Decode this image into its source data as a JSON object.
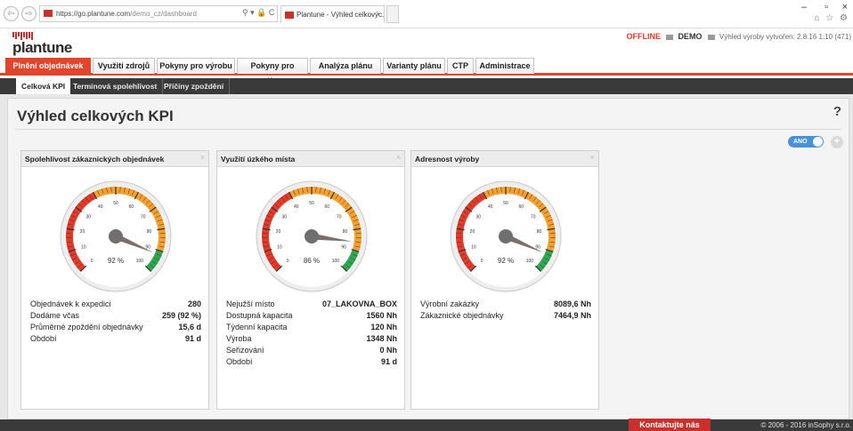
{
  "browser": {
    "url_host": "https://go.plantune.com",
    "url_path": "/demo_cz/dashboard",
    "tab_title": "Plantune - Výhled celkovýc...",
    "tab_close": "×",
    "back": "⇦",
    "forward": "⇨",
    "addr_tools": "⚲ ▾ 🔒 C",
    "minimize": "–",
    "restore": "▫",
    "close": "×",
    "icons": "⌂ ☆ ⚙"
  },
  "header": {
    "logo": "plantune",
    "status": "OFFLINE",
    "mode": "DEMO",
    "version_text": "Výhled výroby vytvořen: 2.8.16 1:10 (471)"
  },
  "main_tabs": [
    {
      "label": "Plnění objednávek"
    },
    {
      "label": "Využití zdrojů"
    },
    {
      "label": "Pokyny pro výrobu"
    },
    {
      "label": "Pokyny pro nákup"
    },
    {
      "label": "Analýza plánu"
    },
    {
      "label": "Varianty plánu"
    },
    {
      "label": "CTP"
    },
    {
      "label": "Administrace"
    }
  ],
  "sub_tabs": [
    {
      "label": "Celková KPI"
    },
    {
      "label": "Terminová spolehlivost"
    },
    {
      "label": "Příčiny zpoždění"
    }
  ],
  "page": {
    "title": "Výhled celkových KPI",
    "help": "?",
    "details_label": "detaily",
    "toggle_label": "ANO",
    "add": "+"
  },
  "widgets": [
    {
      "title": "Spolehlivost zákaznických objednávek",
      "close": "×",
      "gauge_value": 92,
      "gauge_label": "92 %",
      "stats": [
        {
          "label": "Objednávek k expedici",
          "value": "280"
        },
        {
          "label": "Dodáme včas",
          "value": "259 (92 %)"
        },
        {
          "label": "Průměrné zpoždění objednávky",
          "value": "15,6 d"
        },
        {
          "label": "Období",
          "value": "91 d"
        }
      ]
    },
    {
      "title": "Využití úzkého místa",
      "close": "×",
      "gauge_value": 86,
      "gauge_label": "86 %",
      "stats": [
        {
          "label": "Nejužší místo",
          "value": "07_LAKOVNA_BOX"
        },
        {
          "label": "Dostupná kapacita",
          "value": "1560 Nh"
        },
        {
          "label": "Týdenní kapacita",
          "value": "120 Nh"
        },
        {
          "label": "Výroba",
          "value": "1348 Nh"
        },
        {
          "label": "Seřizování",
          "value": "0 Nh"
        },
        {
          "label": "Období",
          "value": "91 d"
        }
      ]
    },
    {
      "title": "Adresnost výroby",
      "close": "×",
      "gauge_value": 92,
      "gauge_label": "92 %",
      "stats": [
        {
          "label": "Výrobní zakázky",
          "value": "8089,6 Nh"
        },
        {
          "label": "Zákaznické objednávky",
          "value": "7464,9 Nh"
        }
      ]
    }
  ],
  "gauge_scale": {
    "min": 0,
    "max": 100,
    "ticks": [
      "0",
      "10",
      "20",
      "30",
      "40",
      "50",
      "60",
      "70",
      "80",
      "90",
      "100"
    ]
  },
  "colors": {
    "accent": "#e2442c",
    "gauge_red": "#e33a2a",
    "gauge_orange": "#f5a031",
    "gauge_green": "#2fa84f",
    "toggle_blue": "#4a90d9"
  },
  "footer": {
    "contact": "Kontaktujte nás",
    "copyright": "© 2006 - 2016 inSophy s.r.o."
  }
}
